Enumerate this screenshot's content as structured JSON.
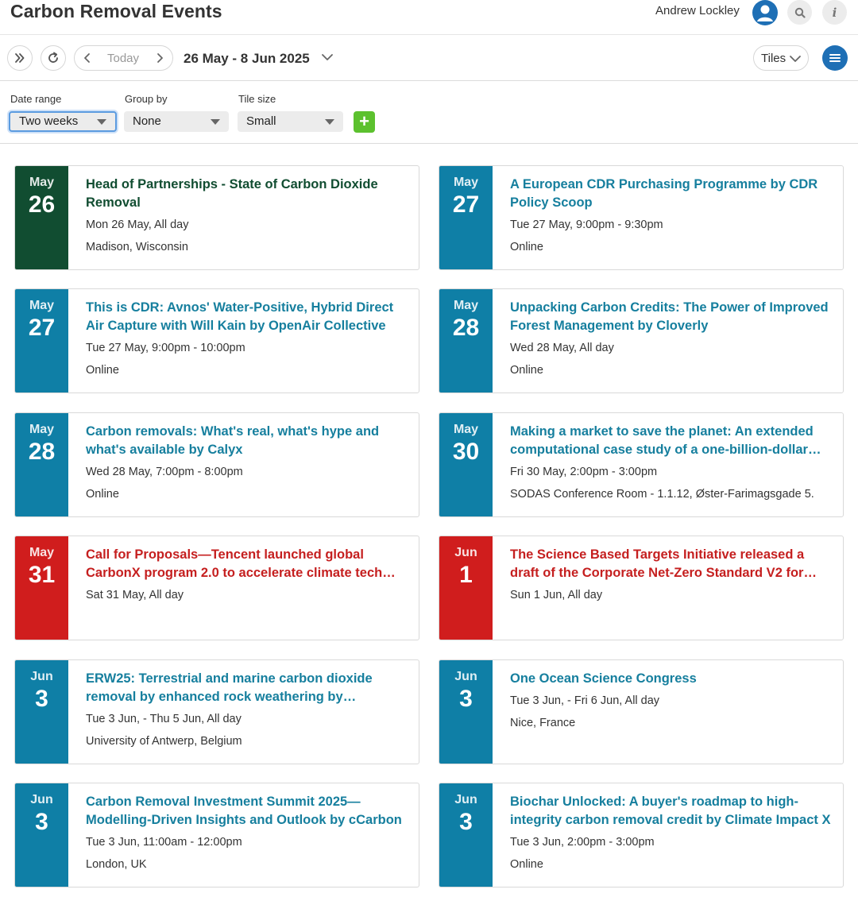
{
  "header": {
    "title": "Carbon Removal Events",
    "user_name": "Andrew Lockley",
    "icons": [
      "avatar-icon",
      "search-icon",
      "info-icon"
    ]
  },
  "toolbar": {
    "today_label": "Today",
    "date_range": "26 May - 8 Jun 2025",
    "view_label": "Tiles",
    "icons": [
      "double-chevron-right-icon",
      "refresh-icon",
      "chevron-left-icon",
      "chevron-right-icon",
      "chevron-down-icon",
      "hamburger-menu-icon"
    ]
  },
  "filters": {
    "date_range": {
      "label": "Date range",
      "value": "Two weeks"
    },
    "group_by": {
      "label": "Group by",
      "value": "None"
    },
    "tile_size": {
      "label": "Tile size",
      "value": "Small"
    },
    "add_label": "+"
  },
  "colors": {
    "brand_blue": "#1e6fb5",
    "tile_blue": "#0f7fa6",
    "tile_green": "#114d31",
    "tile_red": "#d01d1d",
    "title_blue": "#167f9e",
    "title_green": "#114d31",
    "title_red": "#c51f1f"
  },
  "events": [
    {
      "month": "May",
      "day": "26",
      "title": "Head of Partnerships - State of Carbon Dioxide Removal",
      "when": "Mon 26 May, All day",
      "where": "Madison, Wisconsin",
      "color": "green"
    },
    {
      "month": "May",
      "day": "27",
      "title": "A European CDR Purchasing Programme by CDR Policy Scoop",
      "when": "Tue 27 May, 9:00pm - 9:30pm",
      "where": "Online",
      "color": "blue"
    },
    {
      "month": "May",
      "day": "27",
      "title": "This is CDR: Avnos' Water-Positive, Hybrid Direct Air Capture with Will Kain by OpenAir Collective",
      "when": "Tue 27 May, 9:00pm - 10:00pm",
      "where": "Online",
      "color": "blue"
    },
    {
      "month": "May",
      "day": "28",
      "title": "Unpacking Carbon Credits: The Power of Improved Forest Management by Cloverly",
      "when": "Wed 28 May, All day",
      "where": "Online",
      "color": "blue"
    },
    {
      "month": "May",
      "day": "28",
      "title": "Carbon removals: What's real, what's hype and what's available by Calyx",
      "when": "Wed 28 May, 7:00pm - 8:00pm",
      "where": "Online",
      "color": "blue"
    },
    {
      "month": "May",
      "day": "30",
      "title": "Making a market to save the planet: An extended computational case study of a one-billion-dollar…",
      "when": "Fri 30 May, 2:00pm - 3:00pm",
      "where": "SODAS Conference Room - 1.1.12, Øster-Farimagsgade 5.",
      "color": "blue"
    },
    {
      "month": "May",
      "day": "31",
      "title": "Call for Proposals—Tencent launched global CarbonX program 2.0 to accelerate climate tech…",
      "when": "Sat 31 May, All day",
      "where": "",
      "color": "red"
    },
    {
      "month": "Jun",
      "day": "1",
      "title": "The Science Based Targets Initiative released a draft of the Corporate Net-Zero Standard V2 for…",
      "when": "Sun 1 Jun, All day",
      "where": "",
      "color": "red"
    },
    {
      "month": "Jun",
      "day": "3",
      "title": "ERW25: Terrestrial and marine carbon dioxide removal by enhanced rock weathering by…",
      "when": "Tue 3 Jun, - Thu 5 Jun, All day",
      "where": "University of Antwerp, Belgium",
      "color": "blue"
    },
    {
      "month": "Jun",
      "day": "3",
      "title": "One Ocean Science Congress",
      "when": "Tue 3 Jun, - Fri 6 Jun, All day",
      "where": "Nice, France",
      "color": "blue",
      "single_line": true
    },
    {
      "month": "Jun",
      "day": "3",
      "title": "Carbon Removal Investment Summit 2025—Modelling-Driven Insights and Outlook by cCarbon",
      "when": "Tue 3 Jun, 11:00am - 12:00pm",
      "where": "London, UK",
      "color": "blue"
    },
    {
      "month": "Jun",
      "day": "3",
      "title": "Biochar Unlocked: A buyer's roadmap to high-integrity carbon removal credit by Climate Impact X",
      "when": "Tue 3 Jun, 2:00pm - 3:00pm",
      "where": "Online",
      "color": "blue"
    }
  ]
}
